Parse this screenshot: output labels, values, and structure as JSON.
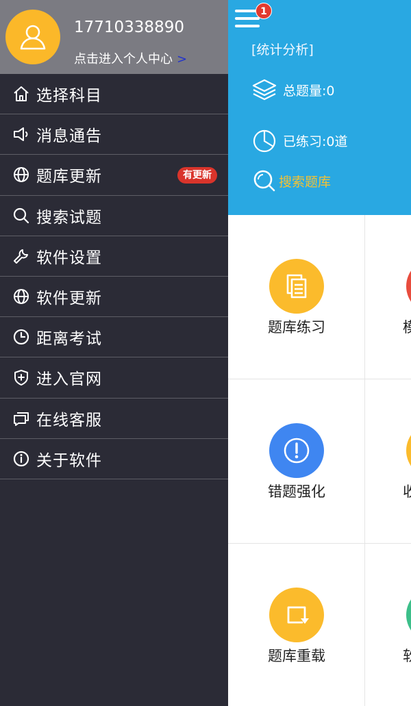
{
  "profile": {
    "phone": "17710338890",
    "enter_center": "点击进入个人中心",
    "arrow": ">"
  },
  "menu": {
    "items": [
      {
        "label": "选择科目",
        "icon": "home-icon"
      },
      {
        "label": "消息通告",
        "icon": "speaker-icon"
      },
      {
        "label": "题库更新",
        "icon": "globe-icon",
        "badge": "有更新"
      },
      {
        "label": "搜索试题",
        "icon": "search-icon"
      },
      {
        "label": "软件设置",
        "icon": "wrench-icon"
      },
      {
        "label": "软件更新",
        "icon": "globe-icon"
      },
      {
        "label": "距离考试",
        "icon": "clock-icon"
      },
      {
        "label": "进入官网",
        "icon": "shield-plus-icon"
      },
      {
        "label": "在线客服",
        "icon": "chat-icon"
      },
      {
        "label": "关于软件",
        "icon": "info-icon"
      }
    ]
  },
  "stats": {
    "notification_count": "1",
    "title": "[统计分析]",
    "total": "总题量:0",
    "practiced": "已练习:0道",
    "search": "搜索题库"
  },
  "grid": {
    "tiles": [
      {
        "label": "题库练习",
        "icon": "document-icon",
        "color": "#fbbb2c"
      },
      {
        "label": "模",
        "icon": "unknown-icon",
        "color": "#e84c3d"
      },
      {
        "label": "错题强化",
        "icon": "alert-icon",
        "color": "#3f86f1"
      },
      {
        "label": "收",
        "icon": "unknown-icon",
        "color": "#fbbb2c"
      },
      {
        "label": "题库重载",
        "icon": "reload-icon",
        "color": "#fbbb2c"
      },
      {
        "label": "软",
        "icon": "unknown-icon",
        "color": "#3cbf8a"
      }
    ]
  },
  "colors": {
    "stats_blue": "#29a8e2",
    "drawer_bg": "#2b2b36",
    "profile_bg": "#7b7b82",
    "avatar": "#fbb829",
    "badge_red": "#d9342b",
    "search_yellow": "#f3c234"
  }
}
